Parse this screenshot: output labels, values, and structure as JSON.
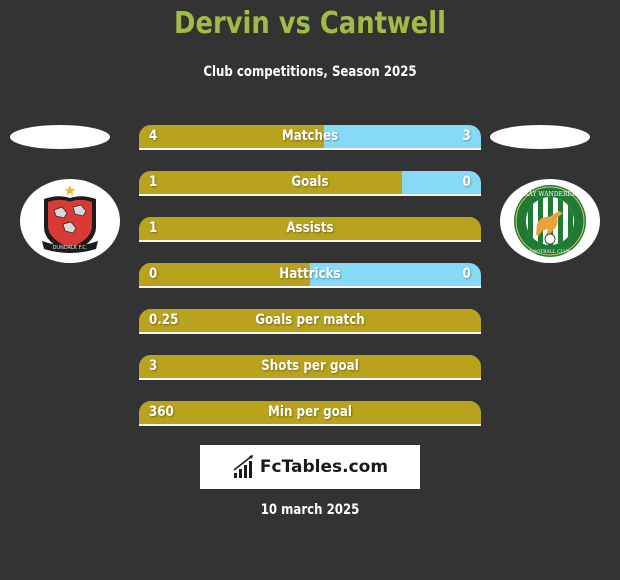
{
  "header": {
    "title": "Dervin vs Cantwell",
    "subtitle": "Club competitions, Season 2025"
  },
  "players": {
    "left": {
      "name": "Dervin",
      "club_logo": "dundalk-fc-crest"
    },
    "right": {
      "name": "Cantwell",
      "club_logo": "bray-wanderers-crest"
    }
  },
  "colors": {
    "background": "#333333",
    "title": "#9fbd44",
    "left_bar": "#b9a21c",
    "right_bar": "#87daf6"
  },
  "stats": [
    {
      "label": "Matches",
      "left": "4",
      "right": "3",
      "left_share": 0.54
    },
    {
      "label": "Goals",
      "left": "1",
      "right": "0",
      "left_share": 0.77
    },
    {
      "label": "Assists",
      "left": "1",
      "right": "",
      "left_share": 1.0
    },
    {
      "label": "Hattricks",
      "left": "0",
      "right": "0",
      "left_share": 0.5
    },
    {
      "label": "Goals per match",
      "left": "0.25",
      "right": "",
      "left_share": 1.0
    },
    {
      "label": "Shots per goal",
      "left": "3",
      "right": "",
      "left_share": 1.0
    },
    {
      "label": "Min per goal",
      "left": "360",
      "right": "",
      "left_share": 1.0
    }
  ],
  "brand": {
    "icon": "bar-chart-icon",
    "text": "FcTables.com"
  },
  "footer": {
    "date": "10 march 2025"
  }
}
